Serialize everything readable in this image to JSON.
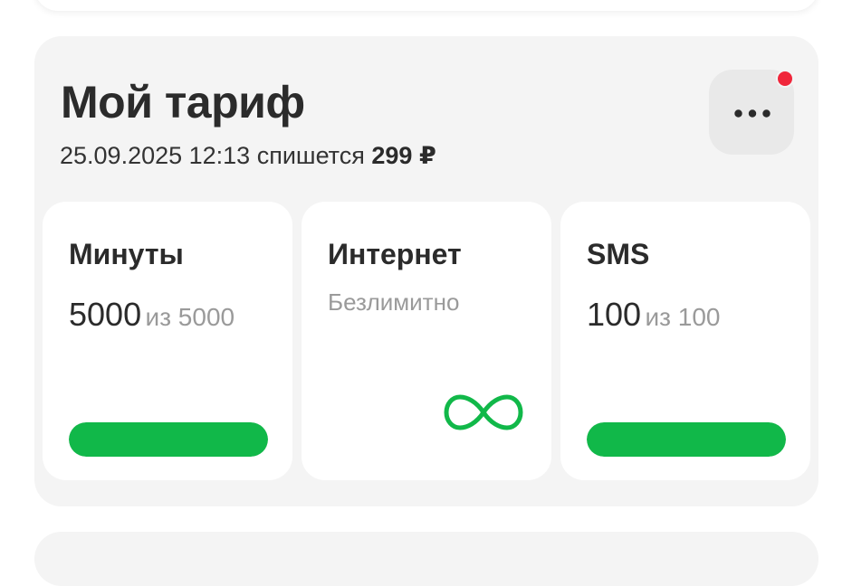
{
  "tariff": {
    "title": "Мой тариф",
    "charge_date": "25.09.2025 12:13 спишется",
    "charge_amount": "299 ₽",
    "menu_icon": "more-horizontal-icon",
    "has_notification": true,
    "notification_color": "#f0263b"
  },
  "tiles": {
    "minutes": {
      "title": "Минуты",
      "remaining": "5000",
      "total_label": "из 5000",
      "progress": 1.0
    },
    "internet": {
      "title": "Интернет",
      "status": "Безлимитно",
      "icon": "infinity-icon"
    },
    "sms": {
      "title": "SMS",
      "remaining": "100",
      "total_label": "из 100",
      "progress": 1.0
    }
  },
  "colors": {
    "accent": "#11b849",
    "card_background": "#f4f4f4",
    "tile_background": "#ffffff",
    "muted_text": "#9a9a9a"
  }
}
